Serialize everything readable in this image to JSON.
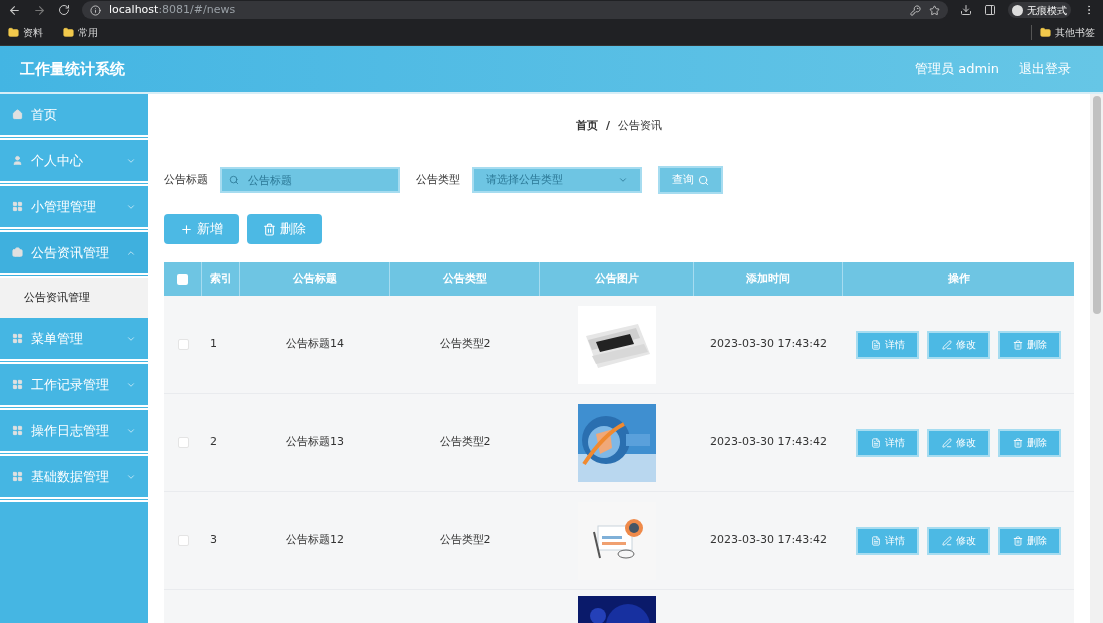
{
  "browser": {
    "url_host": "localhost",
    "url_rest": ":8081/#/news",
    "profile": "无痕模式",
    "bookmarks": [
      "资料",
      "常用"
    ],
    "other_bookmarks": "其他书签"
  },
  "header": {
    "title": "工作量统计系统",
    "user": "管理员 admin",
    "logout": "退出登录"
  },
  "sidebar": {
    "items": [
      {
        "kind": "link",
        "label": "首页"
      },
      {
        "kind": "group",
        "label": "个人中心",
        "expanded": false
      },
      {
        "kind": "group",
        "label": "小管理管理",
        "expanded": false
      },
      {
        "kind": "group",
        "label": "公告资讯管理",
        "expanded": true,
        "children": [
          {
            "label": "公告资讯管理",
            "selected": true
          }
        ]
      },
      {
        "kind": "group",
        "label": "菜单管理",
        "expanded": false
      },
      {
        "kind": "group",
        "label": "工作记录管理",
        "expanded": false
      },
      {
        "kind": "group",
        "label": "操作日志管理",
        "expanded": false
      },
      {
        "kind": "group",
        "label": "基础数据管理",
        "expanded": false
      }
    ]
  },
  "breadcrumb": [
    "首页",
    "公告资讯"
  ],
  "breadcrumb_separator": "/",
  "search": {
    "title_label": "公告标题",
    "title_placeholder": "公告标题",
    "type_label": "公告类型",
    "type_placeholder": "请选择公告类型",
    "query_button": "查询"
  },
  "actions": {
    "add": "新增",
    "delete": "删除"
  },
  "table": {
    "select_all_checked": false,
    "columns": [
      "索引",
      "公告标题",
      "公告类型",
      "公告图片",
      "添加时间",
      "操作"
    ],
    "rows": [
      {
        "kind": "full",
        "checked": false,
        "index": "1",
        "title": "公告标题14",
        "type": "公告类型2",
        "time": "2023-03-30 17:43:42",
        "actions": [
          "详情",
          "修改",
          "删除"
        ]
      },
      {
        "kind": "full",
        "checked": false,
        "index": "2",
        "title": "公告标题13",
        "type": "公告类型2",
        "time": "2023-03-30 17:43:42",
        "actions": [
          "详情",
          "修改",
          "删除"
        ]
      },
      {
        "kind": "full",
        "checked": false,
        "index": "3",
        "title": "公告标题12",
        "type": "公告类型2",
        "time": "2023-03-30 17:43:42",
        "actions": [
          "详情",
          "修改",
          "删除"
        ]
      },
      {
        "kind": "partial"
      }
    ]
  }
}
